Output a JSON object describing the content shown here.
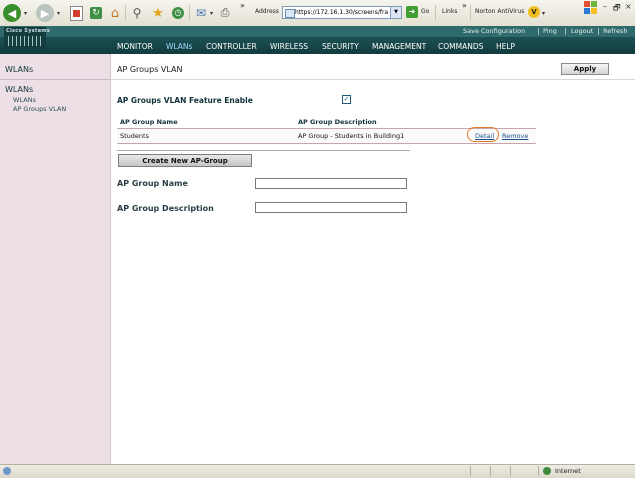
{
  "browser": {
    "chevron": "»",
    "address_label": "Address",
    "url": "https://172.16.1.30/screens/fra",
    "go_label": "Go",
    "links_label": "Links",
    "norton_label": "Norton AntiVirus",
    "window_controls": [
      "–",
      "🗗",
      "×"
    ],
    "status_zone": "Internet"
  },
  "brand": {
    "logo_text": "Cisco Systems"
  },
  "util_links": [
    "Save Configuration",
    "Ping",
    "Logout",
    "Refresh"
  ],
  "menu": [
    {
      "label": "MONITOR",
      "active": false
    },
    {
      "label": "WLANs",
      "active": true
    },
    {
      "label": "CONTROLLER",
      "active": false
    },
    {
      "label": "WIRELESS",
      "active": false
    },
    {
      "label": "SECURITY",
      "active": false
    },
    {
      "label": "MANAGEMENT",
      "active": false
    },
    {
      "label": "COMMANDS",
      "active": false
    },
    {
      "label": "HELP",
      "active": false
    }
  ],
  "sidebar": {
    "title": "WLANs",
    "section": "WLANs",
    "items": [
      "WLANs",
      "AP Groups VLAN"
    ]
  },
  "content": {
    "title": "AP Groups VLAN",
    "apply_label": "Apply",
    "feature_label": "AP Groups VLAN Feature Enable",
    "feature_checked": true,
    "table": {
      "headers": [
        "AP Group Name",
        "AP Group Description"
      ],
      "rows": [
        {
          "name": "Students",
          "description": "AP Group - Students in Building1",
          "detail": "Detail",
          "remove": "Remove"
        }
      ]
    },
    "create_label": "Create New AP-Group",
    "name_label": "AP Group Name",
    "name_value": "",
    "desc_label": "AP Group Description",
    "desc_value": ""
  },
  "colors": {
    "header_dark": "#123c3e",
    "header_top": "#2f6a6c",
    "sidebar_bg": "#ecdfe6",
    "highlight": "#e37a2a",
    "link": "#1b4f8a"
  }
}
